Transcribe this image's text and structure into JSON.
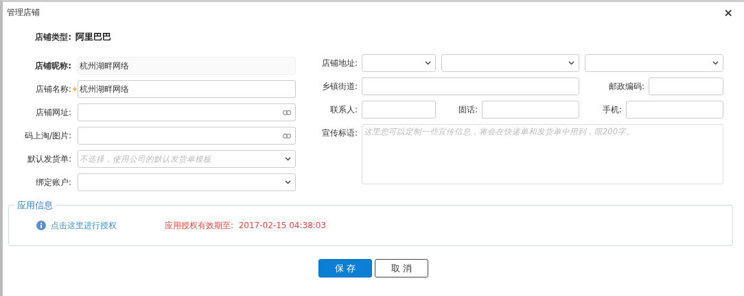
{
  "window": {
    "title": "管理店铺",
    "close": "×"
  },
  "shop_type": {
    "label": "店铺类型:",
    "value": "阿里巴巴"
  },
  "left_fields": [
    {
      "kind": "text",
      "label": "店铺昵称:",
      "value": "杭州湖畔网络",
      "readonly": true,
      "required": false
    },
    {
      "kind": "text",
      "label": "店铺名称:",
      "value": "杭州湖畔网络",
      "readonly": false,
      "required": true
    },
    {
      "kind": "link",
      "label": "店铺网址:",
      "readonly": false,
      "required": false
    },
    {
      "kind": "link",
      "label": "码上淘/图片:",
      "readonly": false,
      "required": false
    },
    {
      "kind": "select",
      "label": "默认发货单:",
      "placeholder": "不选择，使用公司的默认发货单模板",
      "readonly": false,
      "required": false
    },
    {
      "kind": "select",
      "label": "绑定账户:",
      "readonly": false,
      "required": false
    }
  ],
  "right_rows": [
    {
      "label": "店铺地址:",
      "cells": [
        {
          "kind": "select"
        },
        {
          "kind": "select"
        },
        {
          "kind": "select"
        }
      ]
    },
    {
      "label": "乡镇街道:",
      "cells": [
        {
          "kind": "text"
        },
        {
          "kind": "text",
          "label": "邮政编码:"
        }
      ]
    },
    {
      "label": "联系人:",
      "cells": [
        {
          "kind": "text"
        },
        {
          "kind": "text",
          "label": "固话:"
        },
        {
          "kind": "text",
          "label": "手机:"
        }
      ]
    },
    {
      "label": "宣传标语:",
      "cells": [
        {
          "kind": "textarea",
          "placeholder": "这里您可以定制一些宣传信息，将会在快递单和发货单中用到，限200字。"
        }
      ]
    }
  ],
  "app_info": {
    "legend": "应用信息",
    "auth_link": "点击这里进行授权",
    "expiry": "应用授权有效期至:  2017-02-15 04:38:03"
  },
  "buttons": [
    {
      "kind": "primary",
      "label": "保 存"
    },
    {
      "kind": "default",
      "label": "取 消"
    }
  ]
}
